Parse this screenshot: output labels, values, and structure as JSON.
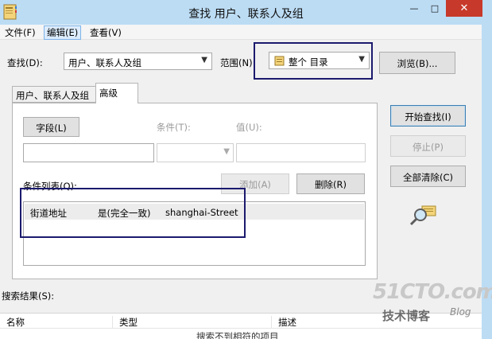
{
  "window": {
    "title": "查找 用户、联系人及组",
    "minimize_glyph": "—",
    "maximize_glyph": "□",
    "close_glyph": "✕"
  },
  "menu": {
    "file": "文件(F)",
    "edit": "编辑(E)",
    "view": "查看(V)"
  },
  "find": {
    "label": "查找(D):",
    "value": "用户、联系人及组"
  },
  "scope": {
    "label": "范围(N):",
    "value": "整个 目录"
  },
  "browse_button": "浏览(B)...",
  "tabs": {
    "contacts": "用户、联系人及组",
    "advanced": "高级"
  },
  "advanced": {
    "field_button": "字段(L)",
    "condition_label": "条件(T):",
    "value_label": "值(U):",
    "condition_list_label": "条件列表(Q):",
    "add_button": "添加(A)",
    "remove_button": "删除(R)",
    "conditions": [
      {
        "field": "街道地址",
        "condition": "是(完全一致)",
        "value": "shanghai-Street"
      }
    ]
  },
  "actions": {
    "start": "开始查找(I)",
    "stop": "停止(P)",
    "clear": "全部清除(C)"
  },
  "results": {
    "label": "搜索结果(S):",
    "columns": {
      "name": "名称",
      "type": "类型",
      "description": "描述"
    },
    "empty_message": "搜索不到相符的项目"
  },
  "watermark": {
    "logo": "51CTO.com",
    "sub": "技术博客",
    "blog": "Blog"
  },
  "colors": {
    "titlebar": "#bcdcf4",
    "close": "#c7392b",
    "highlight_box": "#1b1a6e"
  }
}
